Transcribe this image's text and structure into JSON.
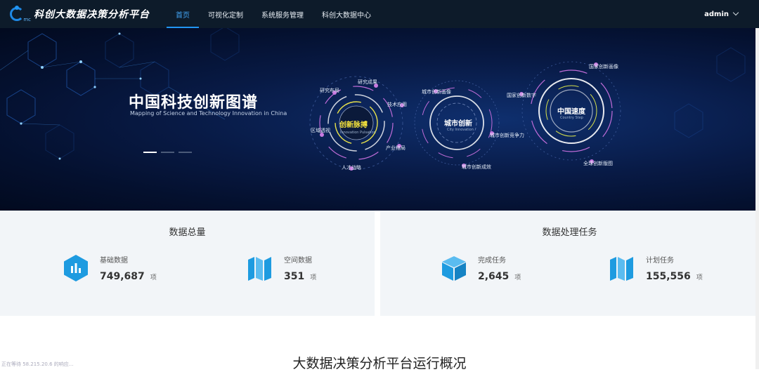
{
  "header": {
    "brand_title": "科创大数据决策分析平台",
    "logo_text": "mc",
    "nav": [
      {
        "label": "首页",
        "active": true
      },
      {
        "label": "可视化定制",
        "active": false
      },
      {
        "label": "系统服务管理",
        "active": false
      },
      {
        "label": "科创大数据中心",
        "active": false
      }
    ],
    "user": "admin"
  },
  "banner": {
    "title": "中国科技创新图谱",
    "subtitle": "Mapping of Science and Technology Innovation in China",
    "slides": 3,
    "active_slide": 1,
    "circle1": {
      "main": "创新脉搏",
      "en": "Innovation Pulsation",
      "labels": [
        "研究成果",
        "研究布局",
        "技术应用",
        "区域透视",
        "产业格局",
        "人才战略"
      ]
    },
    "circle2": {
      "main": "城市创新",
      "en": "City Innovation",
      "labels": [
        "城市创新画像",
        "城市创新竞争力",
        "城市创新成效"
      ]
    },
    "circle3": {
      "main": "中国速度",
      "en": "Country Step",
      "labels": [
        "国家创新画像",
        "国家创新数字",
        "全球创新版图"
      ]
    }
  },
  "stats": {
    "left": {
      "title": "数据总量",
      "items": [
        {
          "label": "基础数据",
          "value": "749,687",
          "unit": "项",
          "icon": "hexagon-chart-icon"
        },
        {
          "label": "空间数据",
          "value": "351",
          "unit": "项",
          "icon": "folded-map-icon"
        }
      ]
    },
    "right": {
      "title": "数据处理任务",
      "items": [
        {
          "label": "完成任务",
          "value": "2,645",
          "unit": "项",
          "icon": "cube-icon"
        },
        {
          "label": "计划任务",
          "value": "155,556",
          "unit": "项",
          "icon": "folded-map-icon"
        }
      ]
    }
  },
  "overview": {
    "title": "大数据决策分析平台运行概况"
  },
  "status_text": "正在等待 58.215.20.6 的响应...",
  "colors": {
    "nav_bg": "#0d1b2a",
    "accent": "#2196f3",
    "banner_bg": "#081a45",
    "panel_bg": "#f2f5f8",
    "icon_blue": "#1e9be0"
  }
}
